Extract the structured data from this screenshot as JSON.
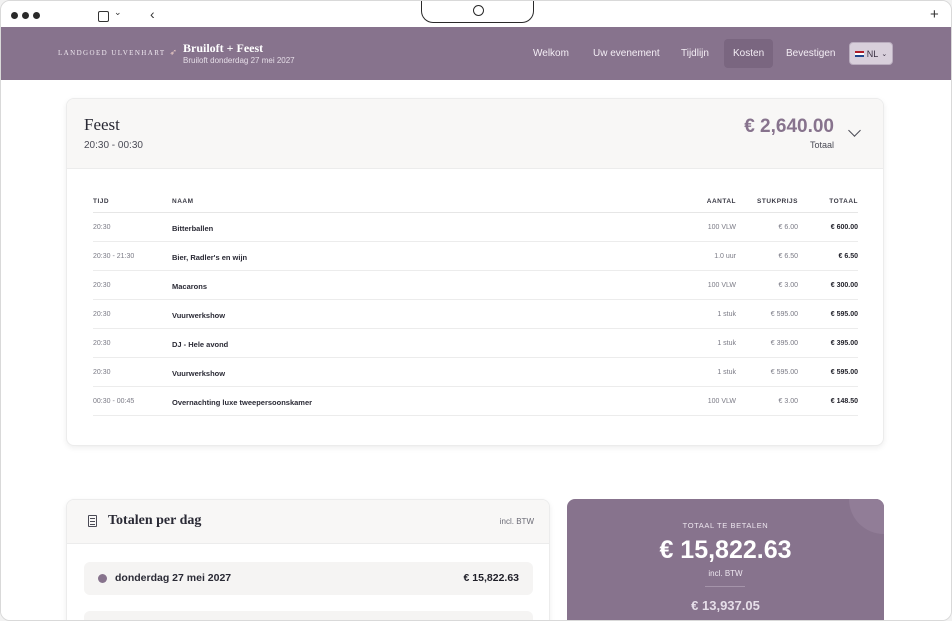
{
  "header": {
    "logo_text": "Landgoed Ulvenhart",
    "event_title": "Bruiloft + Feest",
    "event_subtitle": "Bruiloft donderdag 27 mei 2027",
    "nav": [
      {
        "label": "Welkom"
      },
      {
        "label": "Uw evenement"
      },
      {
        "label": "Tijdlijn"
      },
      {
        "label": "Kosten"
      },
      {
        "label": "Bevestigen"
      }
    ],
    "active_nav": "Kosten",
    "language": "NL"
  },
  "feest": {
    "title": "Feest",
    "time": "20:30 - 00:30",
    "amount": "€ 2,640.00",
    "total_label": "Totaal",
    "columns": {
      "tijd": "TIJD",
      "naam": "NAAM",
      "aantal": "AANTAL",
      "stukprijs": "STUKPRIJS",
      "totaal": "TOTAAL"
    },
    "rows": [
      {
        "tijd": "20:30",
        "naam": "Bitterballen",
        "aantal": "100 VLW",
        "stukprijs": "€ 6.00",
        "totaal": "€ 600.00"
      },
      {
        "tijd": "20:30 - 21:30",
        "naam": "Bier, Radler's en wijn",
        "aantal": "1.0 uur",
        "stukprijs": "€ 6.50",
        "totaal": "€ 6.50"
      },
      {
        "tijd": "20:30",
        "naam": "Macarons",
        "aantal": "100 VLW",
        "stukprijs": "€ 3.00",
        "totaal": "€ 300.00"
      },
      {
        "tijd": "20:30",
        "naam": "Vuurwerkshow",
        "aantal": "1 stuk",
        "stukprijs": "€ 595.00",
        "totaal": "€ 595.00"
      },
      {
        "tijd": "20:30",
        "naam": "DJ - Hele avond",
        "aantal": "1 stuk",
        "stukprijs": "€ 395.00",
        "totaal": "€ 395.00"
      },
      {
        "tijd": "20:30",
        "naam": "Vuurwerkshow",
        "aantal": "1 stuk",
        "stukprijs": "€ 595.00",
        "totaal": "€ 595.00"
      },
      {
        "tijd": "00:30 - 00:45",
        "naam": "Overnachting luxe tweepersoonskamer",
        "aantal": "100 VLW",
        "stukprijs": "€ 3.00",
        "totaal": "€ 148.50"
      }
    ]
  },
  "totals_per_day": {
    "title": "Totalen per dag",
    "btw_note": "incl. BTW",
    "days": [
      {
        "date": "donderdag 27 mei 2027",
        "amount": "€ 15,822.63"
      }
    ]
  },
  "total_to_pay": {
    "label": "TOTAAL TE BETALEN",
    "amount": "€ 15,822.63",
    "btw_note": "incl. BTW",
    "excl_amount": "€ 13,937.05"
  },
  "colors": {
    "brand": "#87738d",
    "brand_dark": "#7a6680"
  }
}
